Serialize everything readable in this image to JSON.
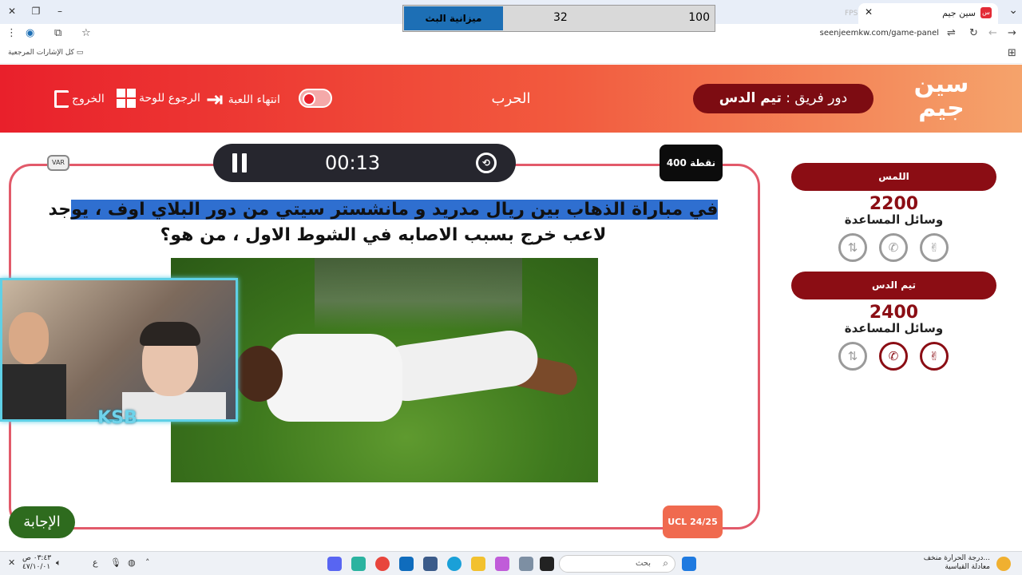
{
  "browser": {
    "tab_title": "سين جيم",
    "url": "seenjeemkw.com/game-panel",
    "bookmarks_label": "كل الإشارات المرجعية",
    "fps_label": "FPS"
  },
  "stream_overlay": {
    "budget_label": "ميزانية البث",
    "value_a": "32",
    "value_b": "100"
  },
  "header": {
    "exit_label": "الخروج",
    "back_label": "الرجوع للوحة",
    "end_game_label": "انتهاء اللعبة",
    "category": "الحرب",
    "turn_prefix": "دور فريق :",
    "turn_team": "تيم الدس",
    "logo_text": "سين جيم"
  },
  "question": {
    "timer": "00:13",
    "points": "400 نقطة",
    "var_badge": "VAR",
    "text_highlighted": "في مباراة الذهاب بين ريال مدريد و مانشستر سيتي من دور البلاي اوف ، يو",
    "text_rest": "جد لاعب خرج بسبب الاصابه في الشوط الاول ، من هو؟",
    "answer_button": "الإجابة",
    "season_badge": "UCL 24/25",
    "streamer_logo": "KSB"
  },
  "teams": [
    {
      "name": "اللمس",
      "score": "2200",
      "aids_label": "وسائل المساعدة",
      "aids": [
        {
          "icon": "swap-phone-icon",
          "active": false
        },
        {
          "icon": "phone-icon",
          "active": false
        },
        {
          "icon": "peace-hand-icon",
          "active": false
        }
      ]
    },
    {
      "name": "تيم الدس",
      "score": "2400",
      "aids_label": "وسائل المساعدة",
      "aids": [
        {
          "icon": "swap-phone-icon",
          "active": false
        },
        {
          "icon": "phone-icon",
          "active": true
        },
        {
          "icon": "peace-hand-icon",
          "active": true
        }
      ]
    }
  ],
  "taskbar": {
    "search_placeholder": "بحث",
    "time": "٠٣:٤٣ ص",
    "date": "٤٧/١٠/٠١",
    "lang": "ع",
    "weather_line1": "درجة الحرارة منخف...",
    "weather_line2": "معادلة القياسية"
  },
  "colors": {
    "header_red": "#e9202b",
    "team_maroon": "#8b0d14",
    "answer_green": "#2e6b1e",
    "highlight_blue": "#2f6fd0"
  }
}
